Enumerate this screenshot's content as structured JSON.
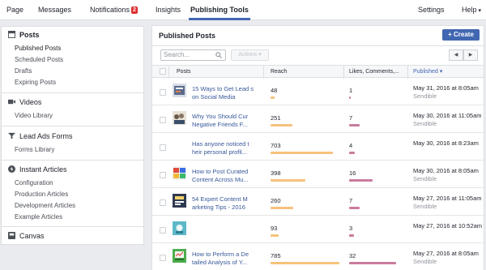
{
  "topnav": {
    "tabs": [
      {
        "label": "Page"
      },
      {
        "label": "Messages"
      },
      {
        "label": "Notifications"
      },
      {
        "label": "Insights"
      },
      {
        "label": "Publishing Tools"
      },
      {
        "label": "Settings"
      },
      {
        "label": "Help"
      }
    ],
    "notifications_badge": "2",
    "help_caret": "▾"
  },
  "sidebar": {
    "posts": {
      "title": "Posts",
      "items": [
        "Published Posts",
        "Scheduled Posts",
        "Drafts",
        "Expiring Posts"
      ]
    },
    "videos": {
      "title": "Videos",
      "items": [
        "Video Library"
      ]
    },
    "leadads": {
      "title": "Lead Ads Forms",
      "items": [
        "Forms Library"
      ]
    },
    "articles": {
      "title": "Instant Articles",
      "items": [
        "Configuration",
        "Production Articles",
        "Development Articles",
        "Example Articles"
      ]
    },
    "canvas": {
      "title": "Canvas"
    }
  },
  "main": {
    "title": "Published Posts",
    "create_label": "+ Create",
    "search_placeholder": "Search...",
    "actions_label": "Actions ▾",
    "pager_prev": "◀",
    "pager_next": "▶",
    "columns": {
      "posts": "Posts",
      "reach": "Reach",
      "engagement": "Likes, Comments,...",
      "published": "Published ▾"
    },
    "rows": [
      {
        "title": "15 Ways to Get Lead s on Social Media",
        "reach": "48",
        "engagement": "1",
        "date": "May 31, 2016 at 8:05am",
        "source": "Sendible"
      },
      {
        "title": "Why You Should Cur Negative Friends F...",
        "reach": "251",
        "engagement": "7",
        "date": "May 30, 2016 at 11:05am",
        "source": "Sendible"
      },
      {
        "title": "Has anyone noticed t heir personal profil...",
        "reach": "703",
        "engagement": "4",
        "date": "May 30, 2016 at 8:23am",
        "source": ""
      },
      {
        "title": "How to Post Curated Content Across Mu...",
        "reach": "398",
        "engagement": "16",
        "date": "May 30, 2016 at 8:05am",
        "source": "Sendible"
      },
      {
        "title": "54 Expert Content M arketing Tips - 2016",
        "reach": "260",
        "engagement": "7",
        "date": "May 27, 2016 at 11:05am",
        "source": "Sendible"
      },
      {
        "title": "",
        "reach": "93",
        "engagement": "3",
        "date": "May 27, 2016 at 10:52am",
        "source": ""
      },
      {
        "title": "How to Perform a De tailed Analysis of Y...",
        "reach": "785",
        "engagement": "32",
        "date": "May 27, 2016 at 8:05am",
        "source": "Sendible"
      }
    ]
  },
  "colors": {
    "accent": "#4267b2",
    "reach_bar": "#f7c27b",
    "engagement_bar": "#c97b9d",
    "link": "#365899"
  }
}
